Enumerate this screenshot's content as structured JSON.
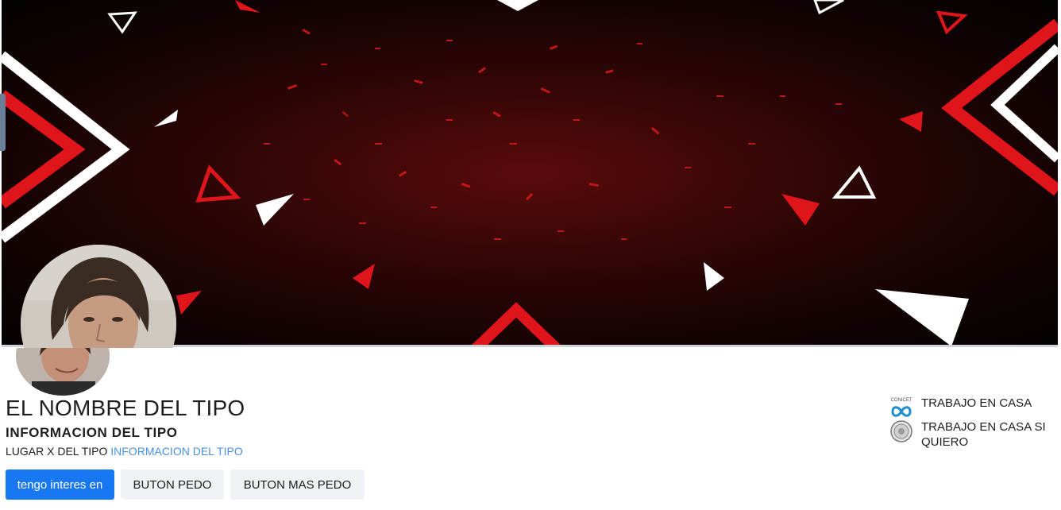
{
  "banner": {
    "image": "red-black-triangles-background",
    "colors": {
      "accent": "#e0141b",
      "dark": "#0d0202",
      "white": "#ffffff"
    }
  },
  "profile": {
    "avatar": "profile-photo",
    "name": "EL NOMBRE DEL TIPO",
    "subtitle": "INFORMACION DEL TIPO",
    "location_text": "LUGAR X DEL TIPO",
    "location_link": "INFORMACION DEL TIPO"
  },
  "actions": {
    "primary_label": "tengo interes en",
    "button2_label": "BUTON PEDO",
    "button3_label": "BUTON MAS PEDO",
    "primary_color": "#1877f2"
  },
  "affiliations": [
    {
      "icon": "conicet-logo-icon",
      "icon_caption": "CONICET",
      "label": "TRABAJO EN CASA"
    },
    {
      "icon": "university-seal-icon",
      "label": "TRABAJO EN CASA SI QUIERO"
    }
  ]
}
